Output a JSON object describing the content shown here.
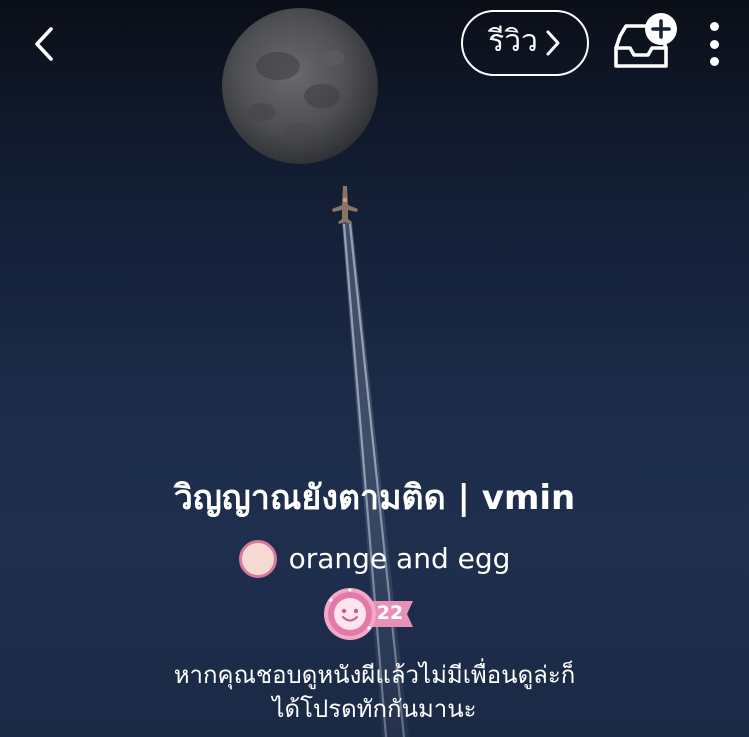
{
  "header": {
    "review_label": "รีวิว"
  },
  "story": {
    "title": "วิญญาณยังตามติด | vmin",
    "author_name": "orange and egg",
    "level": "22",
    "description_line1": "หากคุณชอบดูหนังผีแล้วไม่มีเพื่อนดูล่ะก็",
    "description_line2": "ได้โปรดทักกันมานะ"
  },
  "colors": {
    "sky_top": "#0a0e17",
    "sky_bottom": "#1f3050",
    "badge_pink": "#e58bb4",
    "avatar_fill": "#f7d9d3"
  },
  "icons": {
    "back": "chevron-left-icon",
    "review_arrow": "chevron-right-icon",
    "save": "inbox-add-icon",
    "more": "more-vertical-icon"
  }
}
